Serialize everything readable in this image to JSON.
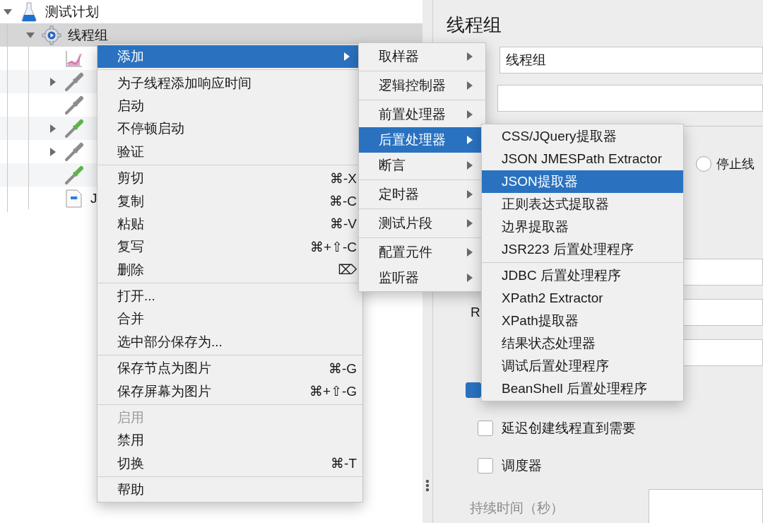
{
  "tree": {
    "items": [
      {
        "label": "测试计划",
        "kind": "flask",
        "expanded": true,
        "selected": false,
        "children": [
          {
            "label": "线程组",
            "kind": "gear",
            "expanded": true,
            "selected": true,
            "children": [
              {
                "kind": "chart",
                "selected": false
              },
              {
                "kind": "dropper-gray",
                "expanded": false,
                "selected": false
              },
              {
                "kind": "dropper-gray",
                "selected": false
              },
              {
                "kind": "dropper-green",
                "expanded": false,
                "selected": false
              },
              {
                "kind": "dropper-gray",
                "expanded": false,
                "selected": false
              },
              {
                "kind": "dropper-green",
                "selected": false
              },
              {
                "label": "J",
                "kind": "script",
                "selected": false
              }
            ]
          }
        ]
      }
    ]
  },
  "form": {
    "title": "线程组",
    "name_field": {
      "value": "线程组"
    },
    "radio": {
      "label": "停止线",
      "selected": false
    },
    "ramp_label": "R",
    "checkboxes": [
      {
        "checked": true
      },
      {
        "label": "延迟创建线程直到需要",
        "checked": false
      },
      {
        "label": "调度器",
        "checked": false
      }
    ],
    "duration": {
      "label": "持续时间（秒）"
    }
  },
  "menus": [
    {
      "items": [
        {
          "kind": "item",
          "label": "添加",
          "submenu": true,
          "selected": true,
          "disabled": false
        },
        {
          "kind": "separator"
        },
        {
          "kind": "item",
          "label": "为子线程添加响应时间",
          "selected": false,
          "disabled": false
        },
        {
          "kind": "item",
          "label": "启动",
          "selected": false,
          "disabled": false
        },
        {
          "kind": "item",
          "label": "不停顿启动",
          "selected": false,
          "disabled": false
        },
        {
          "kind": "item",
          "label": "验证",
          "selected": false,
          "disabled": false
        },
        {
          "kind": "separator"
        },
        {
          "kind": "item",
          "label": "剪切",
          "shortcut": "⌘-X",
          "selected": false,
          "disabled": false
        },
        {
          "kind": "item",
          "label": "复制",
          "shortcut": "⌘-C",
          "selected": false,
          "disabled": false
        },
        {
          "kind": "item",
          "label": "粘贴",
          "shortcut": "⌘-V",
          "selected": false,
          "disabled": false
        },
        {
          "kind": "item",
          "label": "复写",
          "shortcut": "⌘+⇧-C",
          "selected": false,
          "disabled": false
        },
        {
          "kind": "item",
          "label": "删除",
          "shortcut": "⌦",
          "selected": false,
          "disabled": false
        },
        {
          "kind": "separator"
        },
        {
          "kind": "item",
          "label": "打开...",
          "selected": false,
          "disabled": false
        },
        {
          "kind": "item",
          "label": "合并",
          "selected": false,
          "disabled": false
        },
        {
          "kind": "item",
          "label": "选中部分保存为...",
          "selected": false,
          "disabled": false
        },
        {
          "kind": "separator"
        },
        {
          "kind": "item",
          "label": "保存节点为图片",
          "shortcut": "⌘-G",
          "selected": false,
          "disabled": false
        },
        {
          "kind": "item",
          "label": "保存屏幕为图片",
          "shortcut": "⌘+⇧-G",
          "selected": false,
          "disabled": false
        },
        {
          "kind": "separator"
        },
        {
          "kind": "item",
          "label": "启用",
          "selected": false,
          "disabled": true
        },
        {
          "kind": "item",
          "label": "禁用",
          "selected": false,
          "disabled": false
        },
        {
          "kind": "item",
          "label": "切换",
          "shortcut": "⌘-T",
          "selected": false,
          "disabled": false
        },
        {
          "kind": "separator"
        },
        {
          "kind": "item",
          "label": "帮助",
          "selected": false,
          "disabled": false
        }
      ]
    },
    {
      "items": [
        {
          "kind": "item",
          "label": "取样器",
          "submenu": true,
          "selected": false,
          "disabled": false
        },
        {
          "kind": "separator"
        },
        {
          "kind": "item",
          "label": "逻辑控制器",
          "submenu": true,
          "selected": false,
          "disabled": false
        },
        {
          "kind": "separator"
        },
        {
          "kind": "item",
          "label": "前置处理器",
          "submenu": true,
          "selected": false,
          "disabled": false
        },
        {
          "kind": "item",
          "label": "后置处理器",
          "submenu": true,
          "selected": true,
          "disabled": false
        },
        {
          "kind": "item",
          "label": "断言",
          "submenu": true,
          "selected": false,
          "disabled": false
        },
        {
          "kind": "separator"
        },
        {
          "kind": "item",
          "label": "定时器",
          "submenu": true,
          "selected": false,
          "disabled": false
        },
        {
          "kind": "separator"
        },
        {
          "kind": "item",
          "label": "测试片段",
          "submenu": true,
          "selected": false,
          "disabled": false
        },
        {
          "kind": "separator"
        },
        {
          "kind": "item",
          "label": "配置元件",
          "submenu": true,
          "selected": false,
          "disabled": false
        },
        {
          "kind": "item",
          "label": "监听器",
          "submenu": true,
          "selected": false,
          "disabled": false
        }
      ]
    },
    {
      "items": [
        {
          "kind": "item",
          "label": "CSS/JQuery提取器",
          "selected": false,
          "disabled": false
        },
        {
          "kind": "item",
          "label": "JSON JMESPath Extractor",
          "selected": false,
          "disabled": false
        },
        {
          "kind": "item",
          "label": "JSON提取器",
          "selected": true,
          "disabled": false
        },
        {
          "kind": "item",
          "label": "正则表达式提取器",
          "selected": false,
          "disabled": false
        },
        {
          "kind": "item",
          "label": "边界提取器",
          "selected": false,
          "disabled": false
        },
        {
          "kind": "item",
          "label": "JSR223 后置处理程序",
          "selected": false,
          "disabled": false
        },
        {
          "kind": "separator"
        },
        {
          "kind": "item",
          "label": "JDBC 后置处理程序",
          "selected": false,
          "disabled": false
        },
        {
          "kind": "item",
          "label": "XPath2 Extractor",
          "selected": false,
          "disabled": false
        },
        {
          "kind": "item",
          "label": "XPath提取器",
          "selected": false,
          "disabled": false
        },
        {
          "kind": "item",
          "label": "结果状态处理器",
          "selected": false,
          "disabled": false
        },
        {
          "kind": "item",
          "label": "调试后置处理程序",
          "selected": false,
          "disabled": false
        },
        {
          "kind": "item",
          "label": "BeanShell 后置处理程序",
          "selected": false,
          "disabled": false
        }
      ]
    }
  ]
}
